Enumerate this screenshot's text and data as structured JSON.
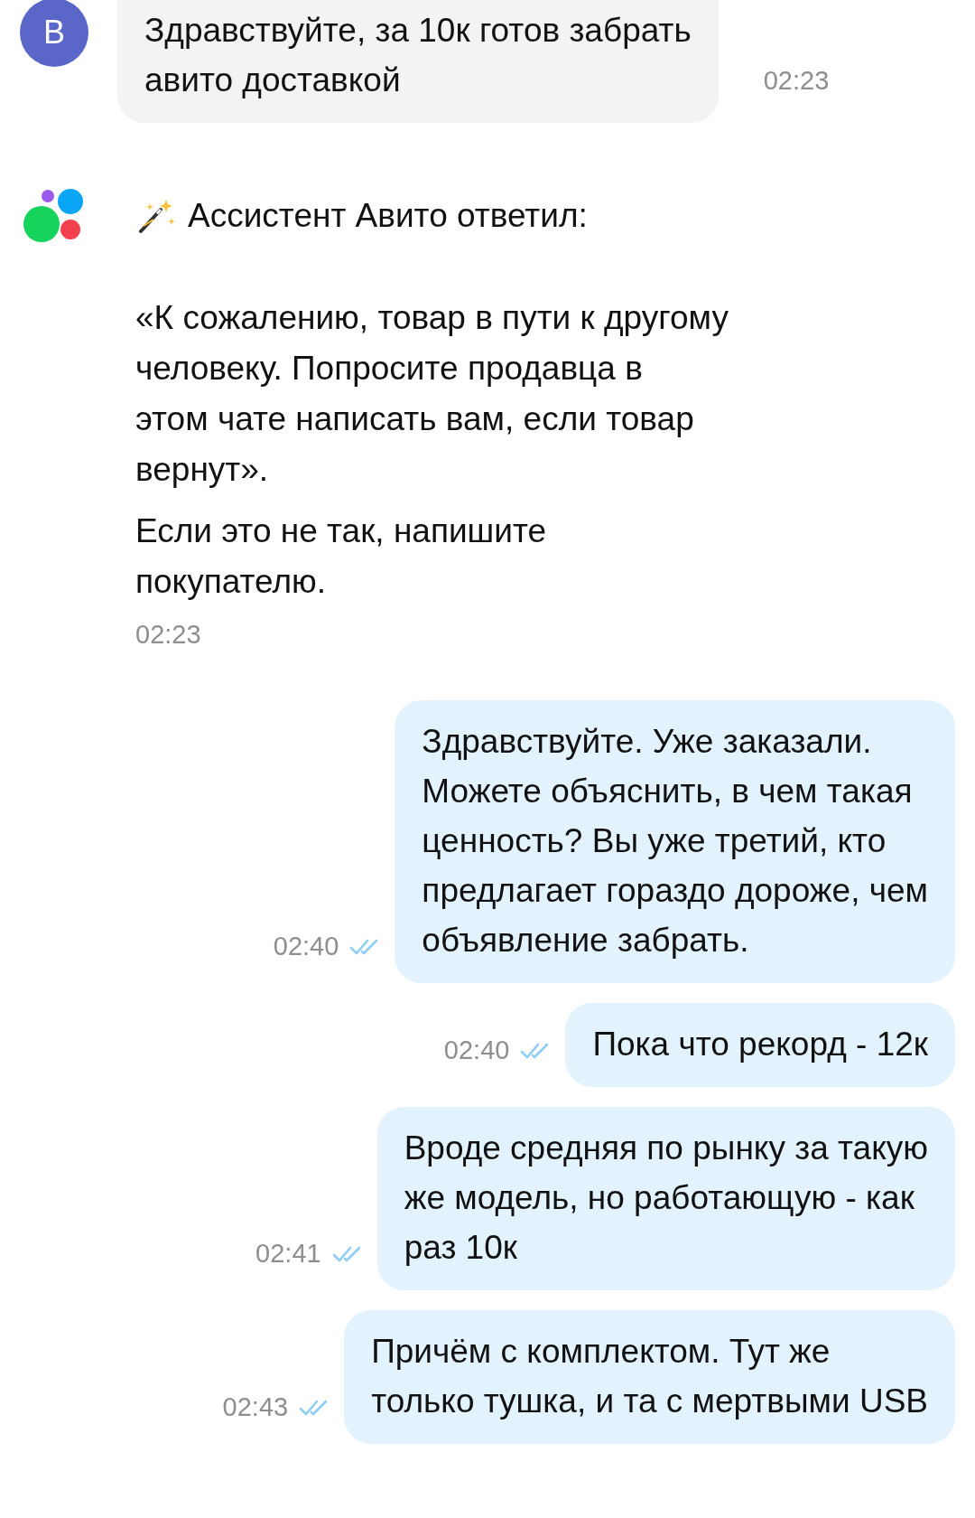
{
  "messages": [
    {
      "kind": "incoming",
      "avatar": "В",
      "text": "Здравствуйте, за 10к готов забрать\nавито доставкой",
      "time": "02:23"
    },
    {
      "kind": "assistant",
      "header": "Ассистент Авито ответил:",
      "paragraphs": [
        "«К сожалению, товар в пути к другому\nчеловеку. Попросите продавца в\nэтом чате написать вам, если товар\nвернут».",
        "Если это не так, напишите\nпокупателю."
      ],
      "time": "02:23"
    },
    {
      "kind": "outgoing",
      "text": "Здравствуйте. Уже заказали.\nМожете объяснить, в чем такая\nценность? Вы уже третий, кто\nпредлагает гораздо дороже, чем\nобъявление забрать.",
      "time": "02:40",
      "read": true
    },
    {
      "kind": "outgoing",
      "text": "Пока что рекорд - 12к",
      "time": "02:40",
      "read": true
    },
    {
      "kind": "outgoing",
      "text": "Вроде средняя по рынку за такую\nже модель, но работающую - как\nраз 10к",
      "time": "02:41",
      "read": true
    },
    {
      "kind": "outgoing",
      "text": "Причём с комплектом. Тут же\nтолько тушка, и та с мертвыми USB",
      "time": "02:43",
      "read": true
    }
  ]
}
